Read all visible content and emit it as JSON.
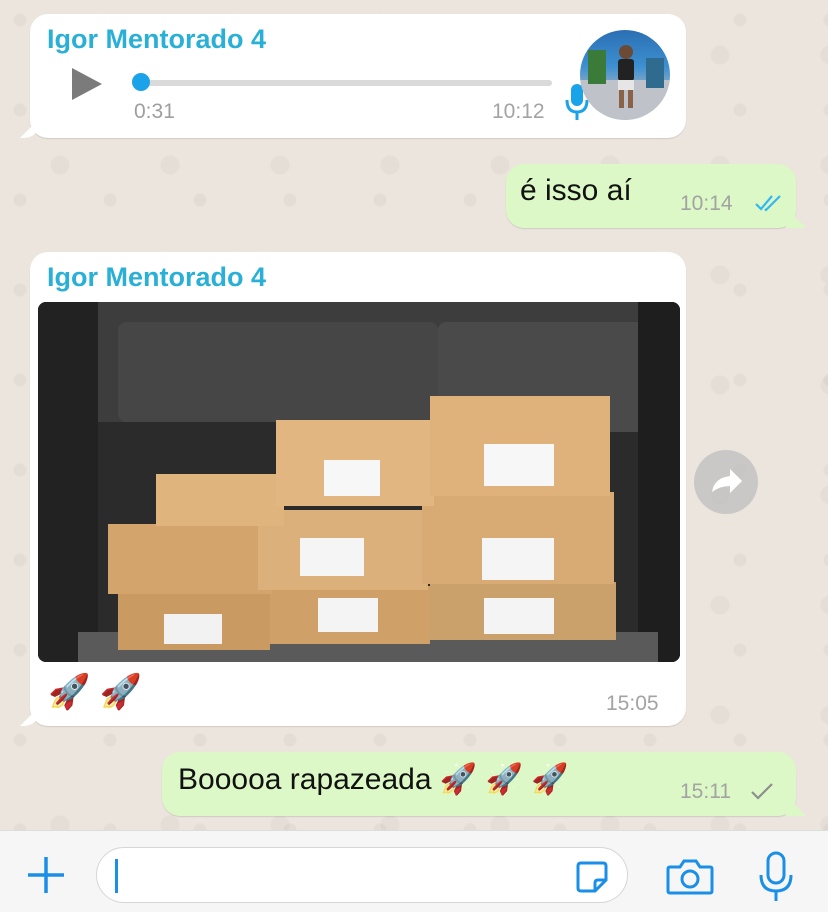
{
  "chat": {
    "messages": [
      {
        "type": "voice",
        "sender": "Igor Mentorado 4",
        "duration": "0:31",
        "time": "10:12",
        "progress": 0.0
      },
      {
        "type": "text",
        "direction": "outgoing",
        "text": "é isso aí",
        "time": "10:14",
        "status": "read"
      },
      {
        "type": "image",
        "sender": "Igor Mentorado 4",
        "caption": "🚀 🚀",
        "time": "15:05"
      },
      {
        "type": "text",
        "direction": "outgoing",
        "text": "Booooa rapazeada 🚀 🚀 🚀",
        "time": "15:11",
        "status": "sent"
      }
    ]
  },
  "composer": {
    "input_value": "",
    "icons": [
      "plus-icon",
      "sticker-icon",
      "camera-icon",
      "microphone-icon"
    ]
  },
  "colors": {
    "accent": "#1a8fe8",
    "sender_name": "#2ab0d6",
    "outgoing_bubble": "#dcf8c6",
    "incoming_bubble": "#ffffff",
    "read_ticks": "#34b7f1",
    "sent_tick": "#8e8e8e"
  }
}
